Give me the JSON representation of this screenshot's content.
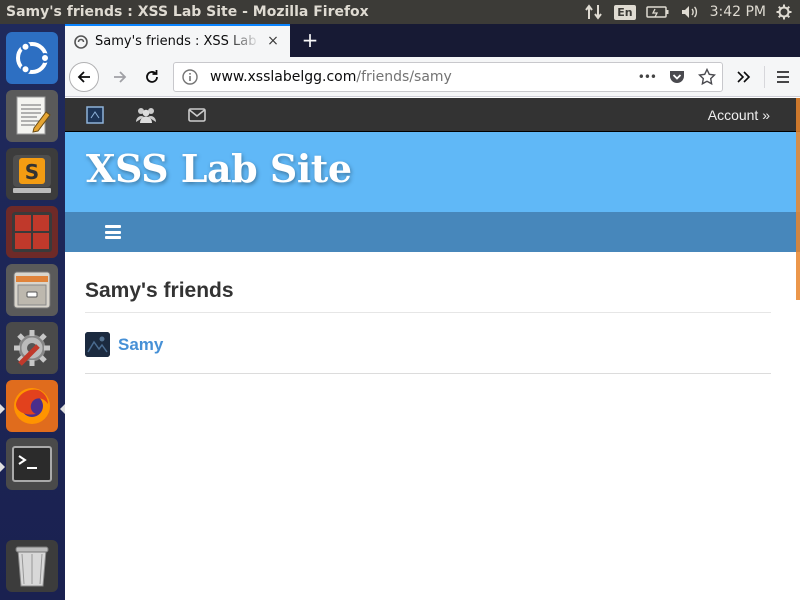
{
  "window_title": "Samy's friends : XSS Lab Site - Mozilla Firefox",
  "indicators": {
    "keyboard": "En",
    "clock": "3:42 PM"
  },
  "launcher": {
    "items": [
      "ubuntu-dash",
      "text-editor",
      "sublime-text",
      "workspace-switcher",
      "files",
      "system-settings",
      "firefox",
      "terminal",
      "trash"
    ]
  },
  "browser": {
    "tab_title": "Samy's friends : XSS Lab Site",
    "tab_close": "×",
    "new_tab": "+",
    "url_host": "www.xsslabelgg.com",
    "url_path": "/friends/samy",
    "overflow_dots": "•••"
  },
  "site": {
    "account_label": "Account »",
    "title": "XSS Lab Site",
    "page_heading": "Samy's friends",
    "friends": [
      {
        "name": "Samy"
      }
    ]
  },
  "colors": {
    "header_blue": "#60b8f7",
    "nav_blue": "#4787bb",
    "link_blue": "#4690d6",
    "topbar_dark": "#333333"
  }
}
